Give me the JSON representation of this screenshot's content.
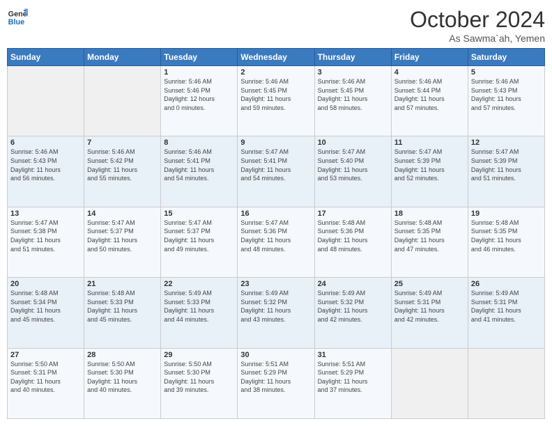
{
  "logo": {
    "line1": "General",
    "line2": "Blue"
  },
  "header": {
    "month": "October 2024",
    "location": "As Sawma`ah, Yemen"
  },
  "days_of_week": [
    "Sunday",
    "Monday",
    "Tuesday",
    "Wednesday",
    "Thursday",
    "Friday",
    "Saturday"
  ],
  "weeks": [
    [
      {
        "day": "",
        "info": ""
      },
      {
        "day": "",
        "info": ""
      },
      {
        "day": "1",
        "info": "Sunrise: 5:46 AM\nSunset: 5:46 PM\nDaylight: 12 hours\nand 0 minutes."
      },
      {
        "day": "2",
        "info": "Sunrise: 5:46 AM\nSunset: 5:45 PM\nDaylight: 11 hours\nand 59 minutes."
      },
      {
        "day": "3",
        "info": "Sunrise: 5:46 AM\nSunset: 5:45 PM\nDaylight: 11 hours\nand 58 minutes."
      },
      {
        "day": "4",
        "info": "Sunrise: 5:46 AM\nSunset: 5:44 PM\nDaylight: 11 hours\nand 57 minutes."
      },
      {
        "day": "5",
        "info": "Sunrise: 5:46 AM\nSunset: 5:43 PM\nDaylight: 11 hours\nand 57 minutes."
      }
    ],
    [
      {
        "day": "6",
        "info": "Sunrise: 5:46 AM\nSunset: 5:43 PM\nDaylight: 11 hours\nand 56 minutes."
      },
      {
        "day": "7",
        "info": "Sunrise: 5:46 AM\nSunset: 5:42 PM\nDaylight: 11 hours\nand 55 minutes."
      },
      {
        "day": "8",
        "info": "Sunrise: 5:46 AM\nSunset: 5:41 PM\nDaylight: 11 hours\nand 54 minutes."
      },
      {
        "day": "9",
        "info": "Sunrise: 5:47 AM\nSunset: 5:41 PM\nDaylight: 11 hours\nand 54 minutes."
      },
      {
        "day": "10",
        "info": "Sunrise: 5:47 AM\nSunset: 5:40 PM\nDaylight: 11 hours\nand 53 minutes."
      },
      {
        "day": "11",
        "info": "Sunrise: 5:47 AM\nSunset: 5:39 PM\nDaylight: 11 hours\nand 52 minutes."
      },
      {
        "day": "12",
        "info": "Sunrise: 5:47 AM\nSunset: 5:39 PM\nDaylight: 11 hours\nand 51 minutes."
      }
    ],
    [
      {
        "day": "13",
        "info": "Sunrise: 5:47 AM\nSunset: 5:38 PM\nDaylight: 11 hours\nand 51 minutes."
      },
      {
        "day": "14",
        "info": "Sunrise: 5:47 AM\nSunset: 5:37 PM\nDaylight: 11 hours\nand 50 minutes."
      },
      {
        "day": "15",
        "info": "Sunrise: 5:47 AM\nSunset: 5:37 PM\nDaylight: 11 hours\nand 49 minutes."
      },
      {
        "day": "16",
        "info": "Sunrise: 5:47 AM\nSunset: 5:36 PM\nDaylight: 11 hours\nand 48 minutes."
      },
      {
        "day": "17",
        "info": "Sunrise: 5:48 AM\nSunset: 5:36 PM\nDaylight: 11 hours\nand 48 minutes."
      },
      {
        "day": "18",
        "info": "Sunrise: 5:48 AM\nSunset: 5:35 PM\nDaylight: 11 hours\nand 47 minutes."
      },
      {
        "day": "19",
        "info": "Sunrise: 5:48 AM\nSunset: 5:35 PM\nDaylight: 11 hours\nand 46 minutes."
      }
    ],
    [
      {
        "day": "20",
        "info": "Sunrise: 5:48 AM\nSunset: 5:34 PM\nDaylight: 11 hours\nand 45 minutes."
      },
      {
        "day": "21",
        "info": "Sunrise: 5:48 AM\nSunset: 5:33 PM\nDaylight: 11 hours\nand 45 minutes."
      },
      {
        "day": "22",
        "info": "Sunrise: 5:49 AM\nSunset: 5:33 PM\nDaylight: 11 hours\nand 44 minutes."
      },
      {
        "day": "23",
        "info": "Sunrise: 5:49 AM\nSunset: 5:32 PM\nDaylight: 11 hours\nand 43 minutes."
      },
      {
        "day": "24",
        "info": "Sunrise: 5:49 AM\nSunset: 5:32 PM\nDaylight: 11 hours\nand 42 minutes."
      },
      {
        "day": "25",
        "info": "Sunrise: 5:49 AM\nSunset: 5:31 PM\nDaylight: 11 hours\nand 42 minutes."
      },
      {
        "day": "26",
        "info": "Sunrise: 5:49 AM\nSunset: 5:31 PM\nDaylight: 11 hours\nand 41 minutes."
      }
    ],
    [
      {
        "day": "27",
        "info": "Sunrise: 5:50 AM\nSunset: 5:31 PM\nDaylight: 11 hours\nand 40 minutes."
      },
      {
        "day": "28",
        "info": "Sunrise: 5:50 AM\nSunset: 5:30 PM\nDaylight: 11 hours\nand 40 minutes."
      },
      {
        "day": "29",
        "info": "Sunrise: 5:50 AM\nSunset: 5:30 PM\nDaylight: 11 hours\nand 39 minutes."
      },
      {
        "day": "30",
        "info": "Sunrise: 5:51 AM\nSunset: 5:29 PM\nDaylight: 11 hours\nand 38 minutes."
      },
      {
        "day": "31",
        "info": "Sunrise: 5:51 AM\nSunset: 5:29 PM\nDaylight: 11 hours\nand 37 minutes."
      },
      {
        "day": "",
        "info": ""
      },
      {
        "day": "",
        "info": ""
      }
    ]
  ]
}
